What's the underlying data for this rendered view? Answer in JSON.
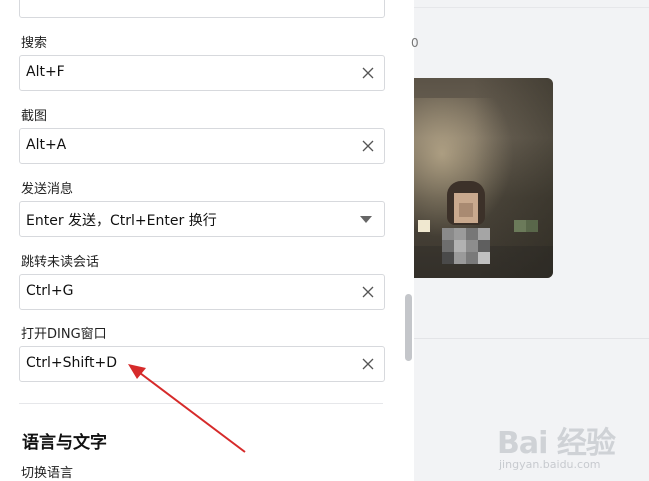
{
  "settings": {
    "fields": [
      {
        "label": "搜索",
        "value": "Alt+F",
        "control": "clear"
      },
      {
        "label": "截图",
        "value": "Alt+A",
        "control": "clear"
      },
      {
        "label": "发送消息",
        "value": "Enter 发送，Ctrl+Enter 换行",
        "control": "dropdown"
      },
      {
        "label": "跳转未读会话",
        "value": "Ctrl+G",
        "control": "clear"
      },
      {
        "label": "打开DING窗口",
        "value": "Ctrl+Shift+D",
        "control": "clear"
      }
    ],
    "section_title": "语言与文字",
    "language_label": "切换语言"
  },
  "right_pane": {
    "partial_text": "0"
  },
  "watermark": {
    "main": "Bai 经验",
    "sub": "jingyan.baidu.com"
  },
  "colors": {
    "annotation_arrow": "#d62a2a",
    "panel_bg": "#ffffff",
    "page_bg": "#f2f3f5"
  }
}
